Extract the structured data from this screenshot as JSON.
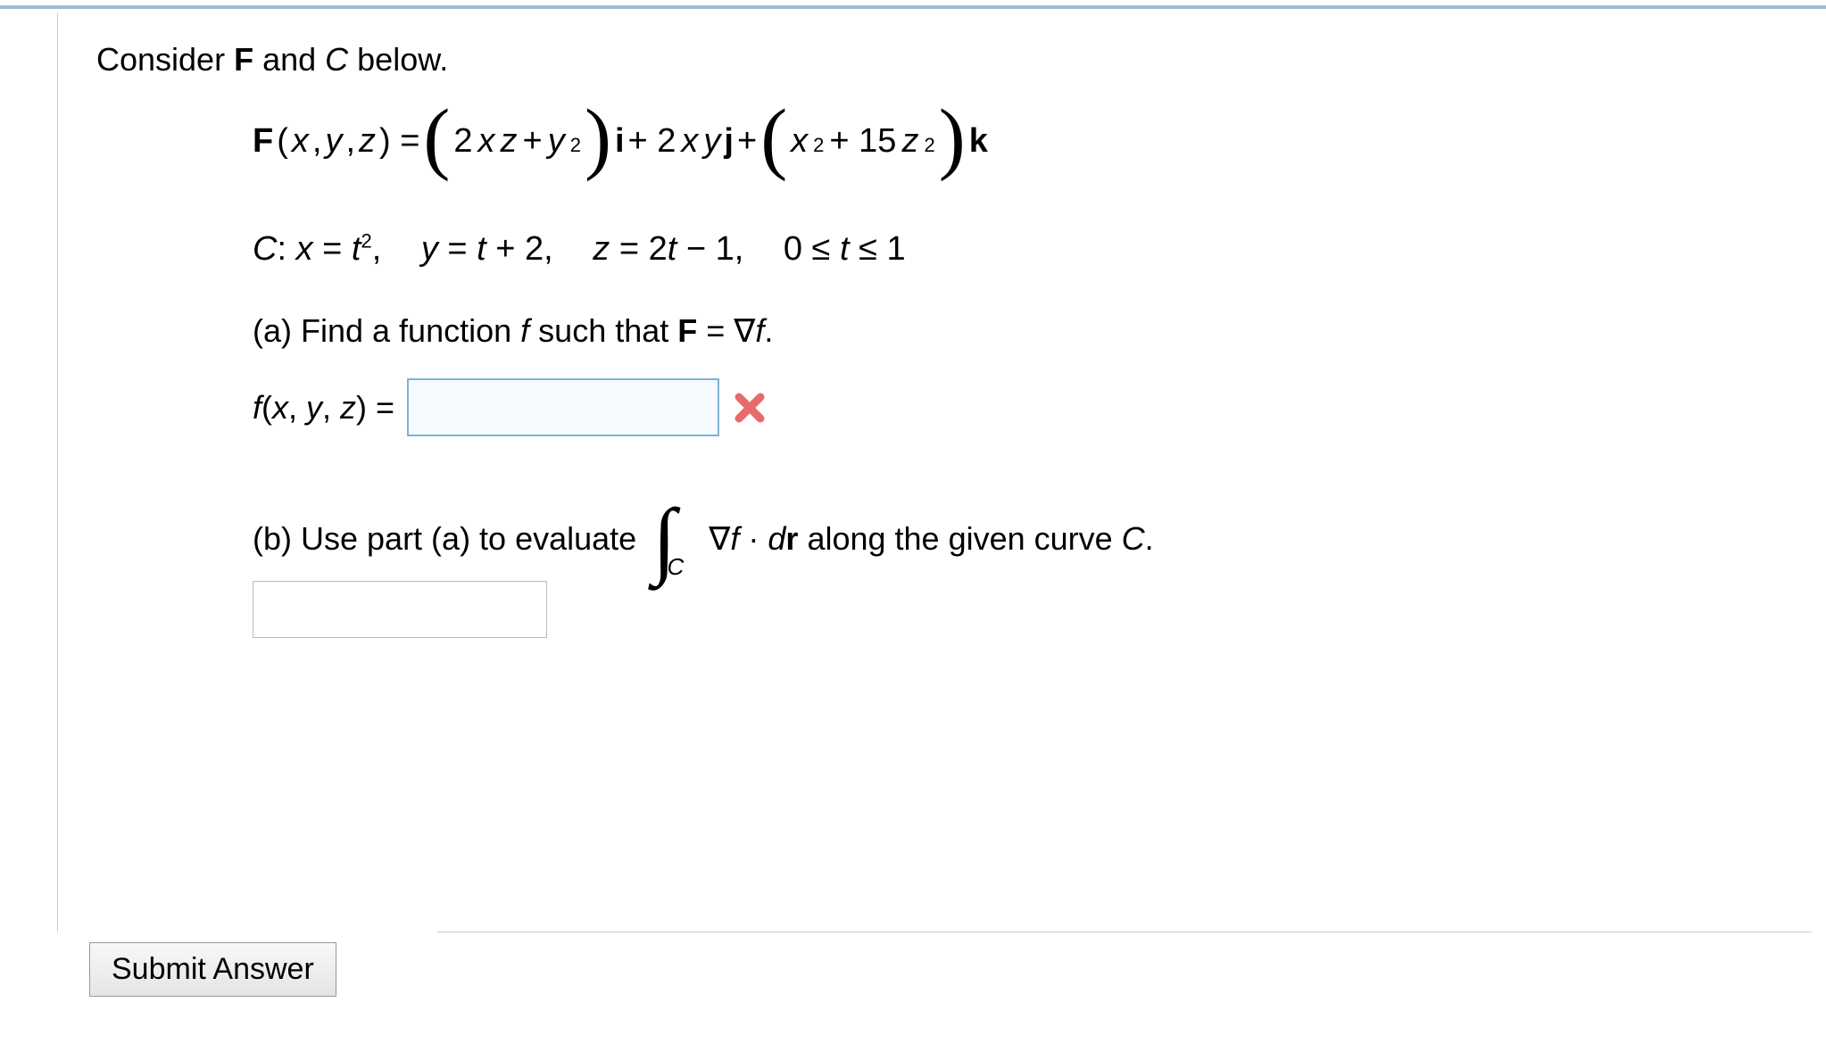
{
  "prompt": {
    "prefix": "Consider ",
    "F": "F",
    "mid": " and ",
    "C": "C",
    "suffix": " below."
  },
  "equationF": {
    "lhs_F": "F",
    "lhs_args": "(",
    "x": "x",
    "c1": ", ",
    "y": "y",
    "c2": ", ",
    "z": "z",
    "lhs_close": ") = ",
    "term1_a": "2",
    "term1_x": "x",
    "term1_z": "z",
    "plus1": " + ",
    "term1_y": "y",
    "term1_exp": "2",
    "i": " i",
    "plus2": " + 2",
    "term2_x": "x",
    "term2_y": "y",
    "j": " j",
    "plus3": " + ",
    "term3_x": "x",
    "term3_exp1": "2",
    "plus4": " + 15",
    "term3_z": "z",
    "term3_exp2": "2",
    "k": " k"
  },
  "curve": {
    "C": "C",
    "colon": ": ",
    "x": "x",
    "eq1": " = ",
    "t1": "t",
    "exp1": "2",
    "sep1": ",",
    "y": "y",
    "eq2": " = ",
    "t2": "t",
    "p2": " + 2,",
    "z": "z",
    "eq3": " = 2",
    "t3": "t",
    "m1": " − 1,",
    "range_pre": "0 ≤ ",
    "trange": "t",
    "range_post": " ≤ 1"
  },
  "partA": {
    "label": "(a) Find a function ",
    "f": "f",
    "mid": " such that ",
    "F": "F",
    "eq": " = ∇",
    "f2": "f",
    "dot": ".",
    "answer_label_f": "f",
    "answer_label_open": "(",
    "ax": "x",
    "ac1": ", ",
    "ay": "y",
    "ac2": ", ",
    "az": "z",
    "answer_label_close": ") = ",
    "input_value": "",
    "input_placeholder": ""
  },
  "partB": {
    "label": "(b) Use part (a) to evaluate ",
    "sub": "C",
    "grad": "∇",
    "f": "f",
    "dot": " · ",
    "d": "d",
    "r": "r",
    "tail": "  along the given curve ",
    "C2": "C",
    "period": ".",
    "input_value": ""
  },
  "submit": {
    "label": "Submit Answer"
  }
}
